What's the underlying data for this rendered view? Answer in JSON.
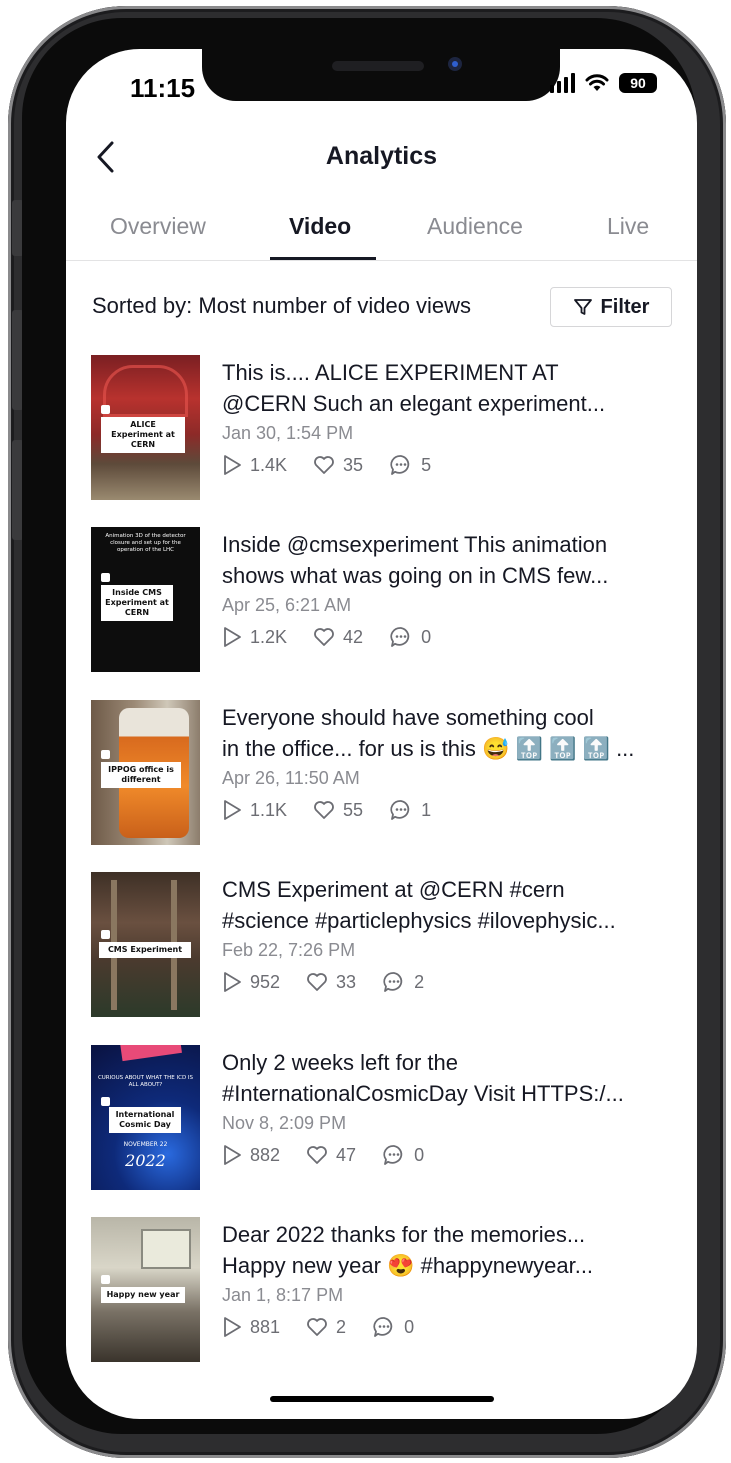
{
  "status_bar": {
    "time": "11:15",
    "battery": "90"
  },
  "header": {
    "title": "Analytics",
    "back_icon": "chevron-left-icon"
  },
  "tabs": [
    {
      "label": "Overview",
      "active": false
    },
    {
      "label": "Video",
      "active": true
    },
    {
      "label": "Audience",
      "active": false
    },
    {
      "label": "Live",
      "active": false
    }
  ],
  "sort": {
    "label": "Sorted by: Most number of video views",
    "filter_label": "Filter"
  },
  "videos": [
    {
      "line1": "This is.... ALICE EXPERIMENT AT",
      "line2": "@CERN  Such an elegant experiment...",
      "date": "Jan 30, 1:54 PM",
      "views": "1.4K",
      "likes": "35",
      "comments": "5",
      "thumb_label": "ALICE Experiment at CERN",
      "thumb_top": ""
    },
    {
      "line1": "Inside @cmsexperiment This animation",
      "line2": "shows what was going on in CMS few...",
      "date": "Apr 25, 6:21 AM",
      "views": "1.2K",
      "likes": "42",
      "comments": "0",
      "thumb_label": "Inside CMS Experiment at CERN",
      "thumb_top": "Animation 3D of the detector closure and set up for the operation of the LHC"
    },
    {
      "line1": "Everyone should have something cool",
      "line2": "in the office... for us is this 😅 🔝 🔝 🔝 ...",
      "date": "Apr 26, 11:50 AM",
      "views": "1.1K",
      "likes": "55",
      "comments": "1",
      "thumb_label": "IPPOG office is different",
      "thumb_top": ""
    },
    {
      "line1": "CMS Experiment at @CERN #cern",
      "line2": "#science #particlephysics #ilovephysic...",
      "date": "Feb 22, 7:26 PM",
      "views": "952",
      "likes": "33",
      "comments": "2",
      "thumb_label": "CMS Experiment",
      "thumb_top": ""
    },
    {
      "line1": "Only 2 weeks left for the",
      "line2": "#InternationalCosmicDay Visit HTTPS:/...",
      "date": "Nov 8, 2:09 PM",
      "views": "882",
      "likes": "47",
      "comments": "0",
      "thumb_label": "International Cosmic Day",
      "thumb_top": "CURIOUS ABOUT WHAT THE ICD IS ALL ABOUT?",
      "thumb_extra": "NOVEMBER 22",
      "thumb_year": "2022"
    },
    {
      "line1": "Dear 2022 thanks for the memories...",
      "line2": "Happy new year 😍  #happynewyear...",
      "date": "Jan 1, 8:17 PM",
      "views": "881",
      "likes": "2",
      "comments": "0",
      "thumb_label": "Happy new year",
      "thumb_top": ""
    }
  ]
}
